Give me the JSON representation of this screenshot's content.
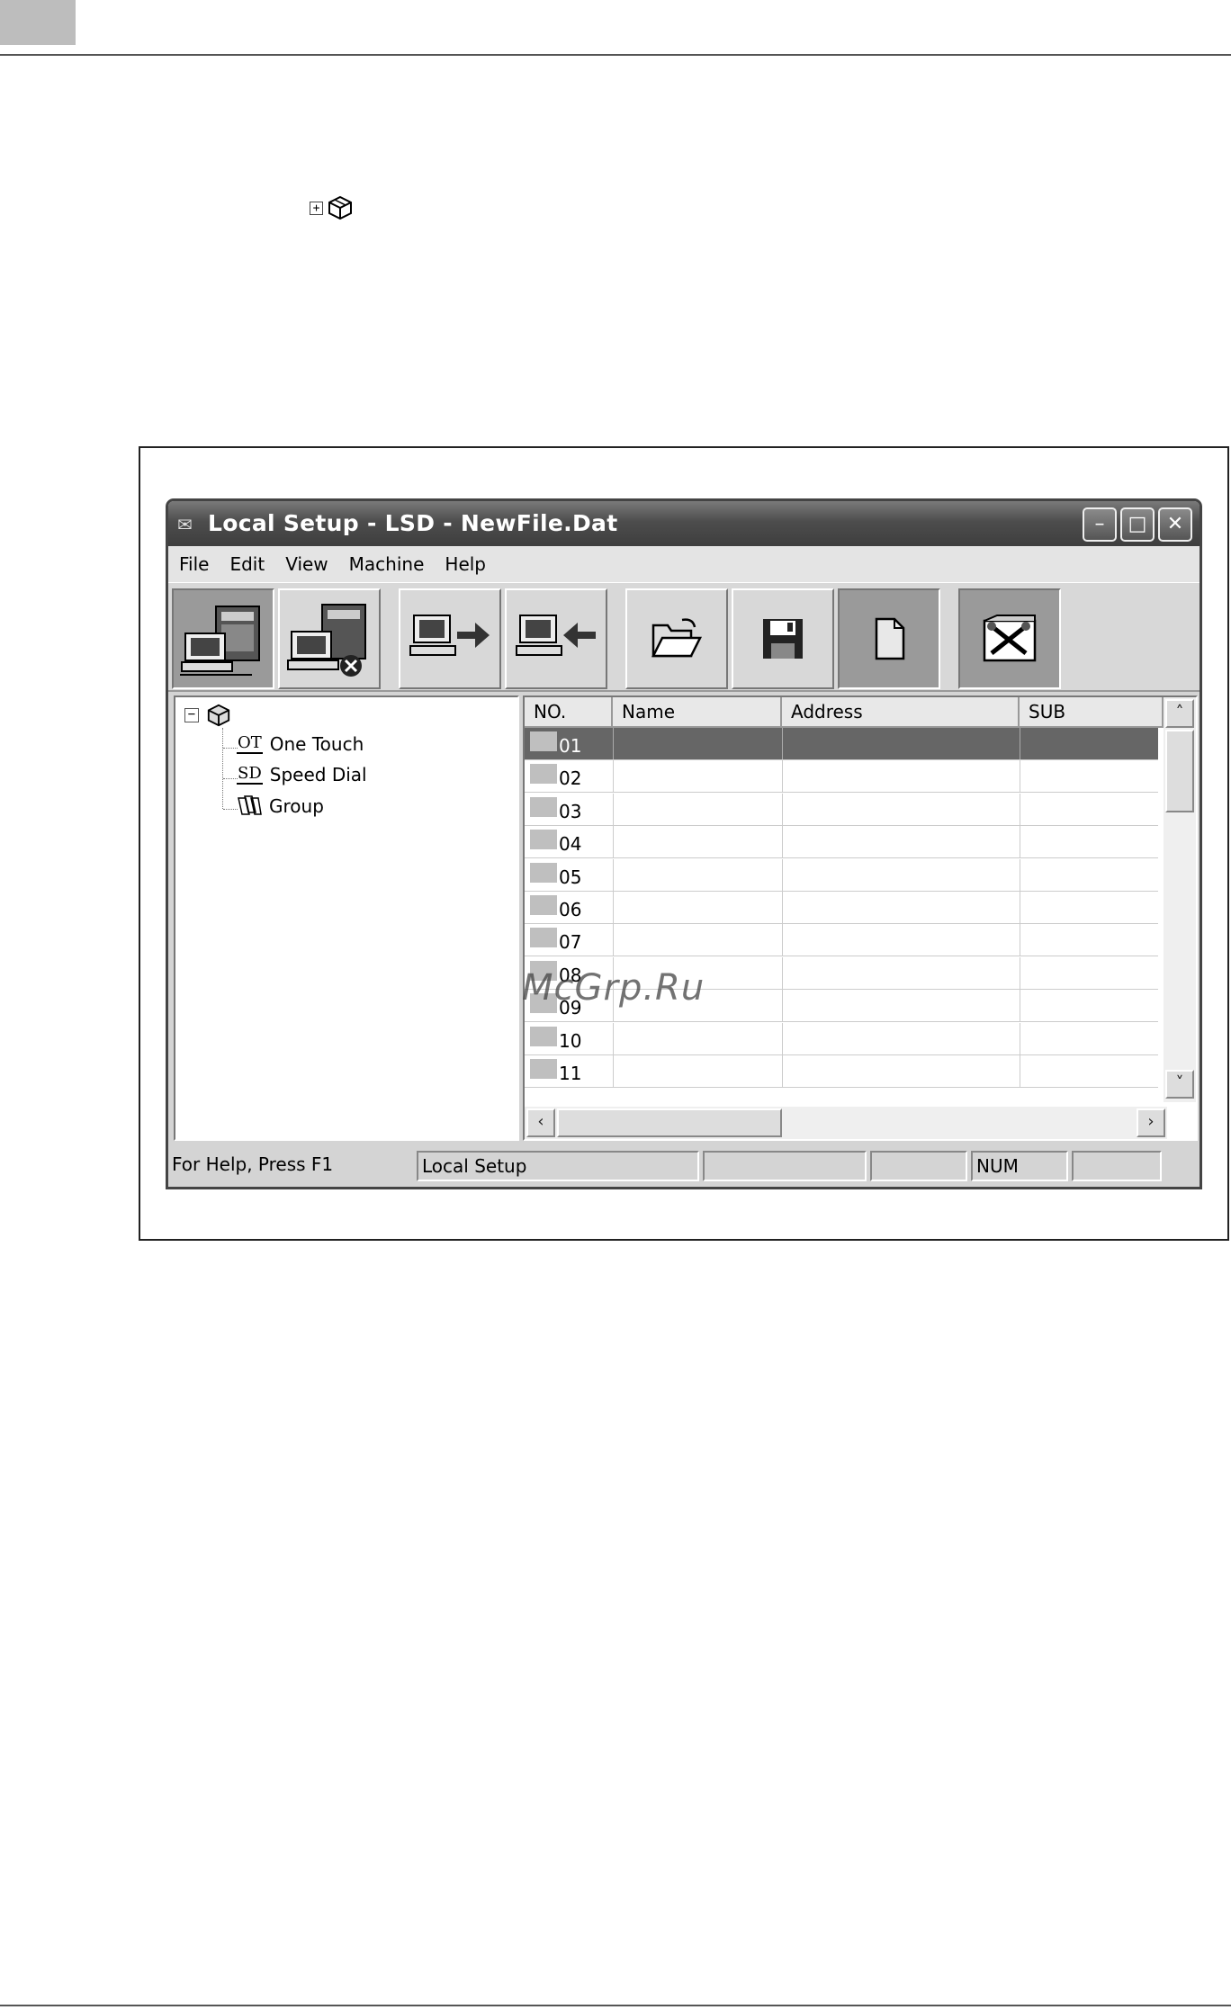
{
  "window": {
    "title": "Local Setup - LSD - NewFile.Dat",
    "buttons": {
      "minimize": "–",
      "maximize": "□",
      "close": "✕"
    }
  },
  "menu": [
    "File",
    "Edit",
    "View",
    "Machine",
    "Help"
  ],
  "toolbar": [
    {
      "icon": "receive-from-machine-icon",
      "pressed": true
    },
    {
      "icon": "disconnect-machine-icon",
      "pressed": false
    },
    {
      "icon": "upload-to-machine-icon",
      "pressed": false
    },
    {
      "icon": "download-from-machine-icon",
      "pressed": false
    },
    {
      "icon": "open-folder-icon",
      "pressed": false
    },
    {
      "icon": "save-disk-icon",
      "pressed": false
    },
    {
      "icon": "new-file-icon",
      "pressed": true
    },
    {
      "icon": "settings-tools-icon",
      "pressed": true
    }
  ],
  "tree": {
    "items": [
      {
        "glyph": "OT",
        "label": "One Touch"
      },
      {
        "glyph": "SD",
        "label": "Speed Dial"
      },
      {
        "glyph": "group",
        "label": "Group"
      }
    ]
  },
  "list": {
    "columns": [
      "NO.",
      "Name",
      "Address",
      "SUB"
    ],
    "rows": [
      "01",
      "02",
      "03",
      "04",
      "05",
      "06",
      "07",
      "08",
      "09",
      "10",
      "11"
    ],
    "selected_row": "01"
  },
  "status": {
    "help": "For Help, Press F1",
    "mode": "Local Setup",
    "num": "NUM"
  },
  "watermark": "McGrp.Ru"
}
